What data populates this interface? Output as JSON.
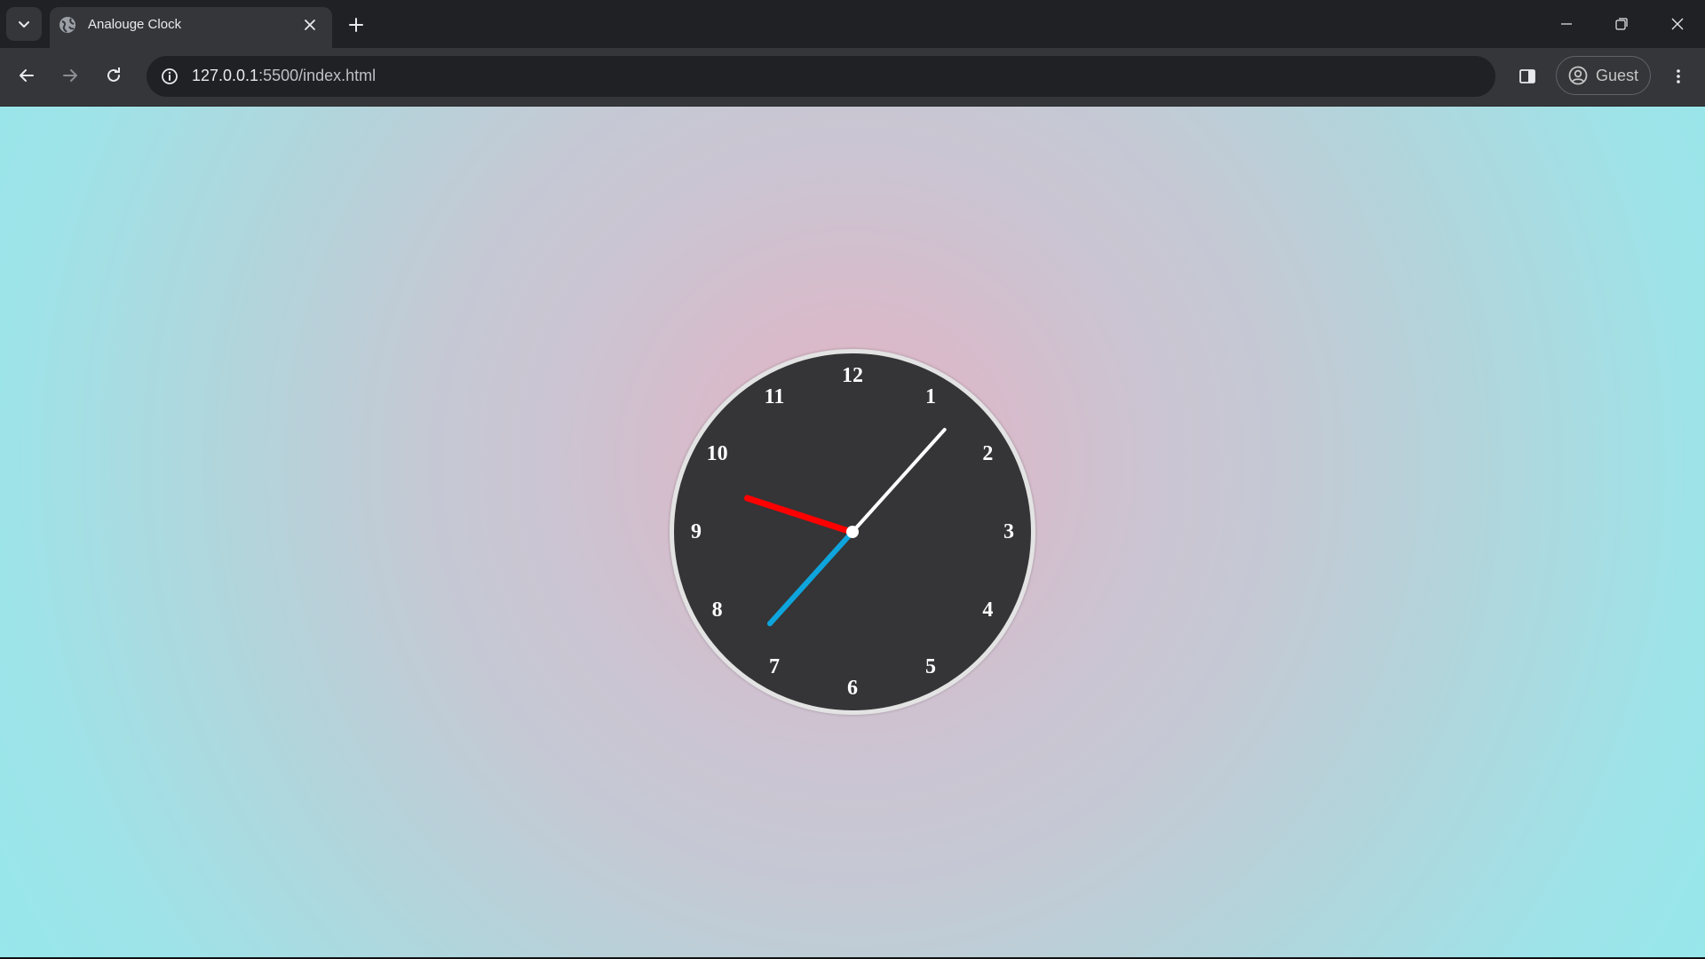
{
  "browser": {
    "tab_title": "Analouge Clock",
    "url_host": "127.0.0.1",
    "url_path": ":5500/index.html",
    "profile_label": "Guest",
    "icons": {
      "tab_search": "chevron-down-icon",
      "favicon": "globe-icon",
      "tab_close": "close-icon",
      "new_tab": "plus-icon",
      "minimize": "minimize-icon",
      "restore": "restore-icon",
      "close_window": "close-icon",
      "back": "arrow-left-icon",
      "forward": "arrow-right-icon",
      "reload": "reload-icon",
      "site_info": "info-icon",
      "side_panel": "side-panel-icon",
      "profile": "account-circle-icon",
      "menu": "kebab-menu-icon"
    }
  },
  "clock": {
    "numbers": [
      "12",
      "1",
      "2",
      "3",
      "4",
      "5",
      "6",
      "7",
      "8",
      "9",
      "10",
      "11"
    ],
    "colors": {
      "face": "#353436",
      "rim": "#e3e3e3",
      "numbers": "#ffffff",
      "hour_hand": "#ff0000",
      "minute_hand": "#0ea5dd",
      "second_hand": "#ffffff"
    },
    "time": {
      "hour_hand_angle_deg": 288,
      "minute_hand_angle_deg": 222,
      "second_hand_angle_deg": 42
    }
  }
}
